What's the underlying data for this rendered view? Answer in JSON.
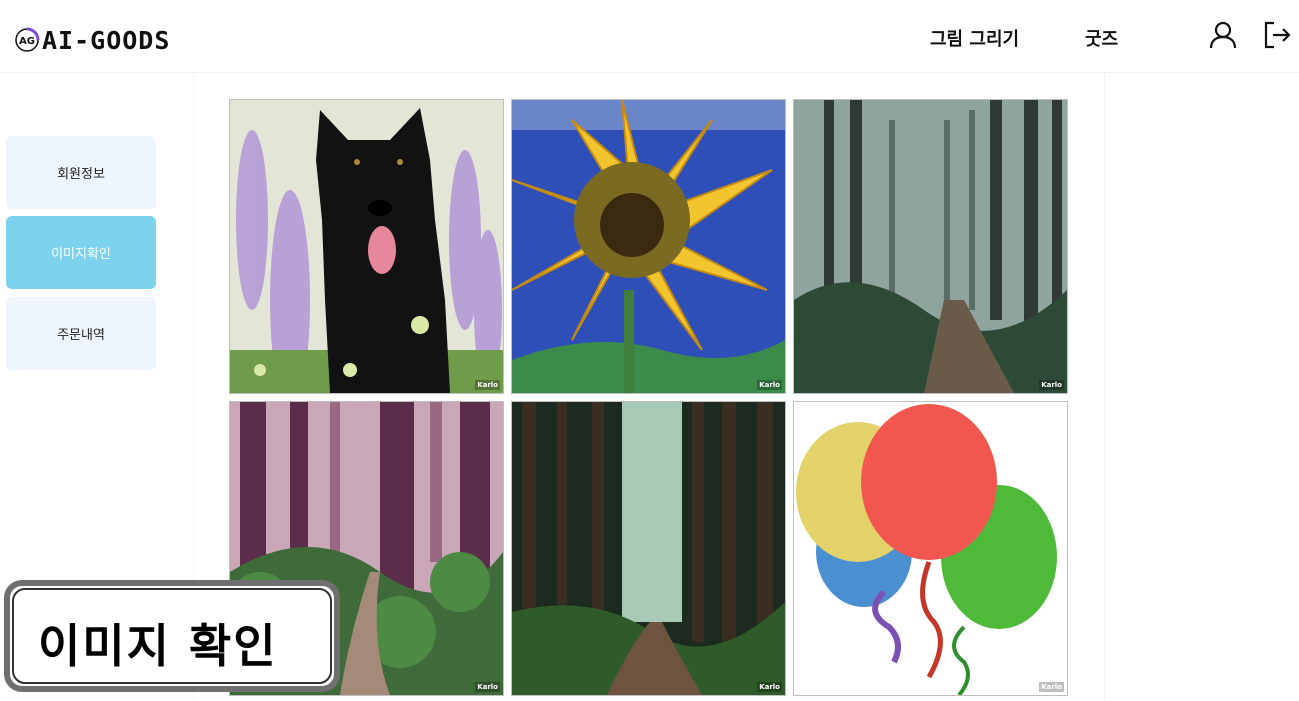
{
  "header": {
    "logo_text": "AI-GOODS",
    "logo_mark_text": "AG",
    "nav": {
      "draw_label": "그림 그리기",
      "goods_label": "굿즈"
    },
    "icons": [
      "user-icon",
      "logout-icon"
    ]
  },
  "sidebar": {
    "items": [
      {
        "label": "회원정보",
        "active": false
      },
      {
        "label": "이미지확인",
        "active": true
      },
      {
        "label": "주문내역",
        "active": false
      }
    ],
    "accent_color": "#7dd3ee",
    "item_bg": "#eef5fd"
  },
  "gallery": {
    "watermark": "Karlo",
    "images": [
      {
        "subject": "black-dog-lavender"
      },
      {
        "subject": "sunflower-painting"
      },
      {
        "subject": "misty-forest-path"
      },
      {
        "subject": "illustrated-purple-forest"
      },
      {
        "subject": "dense-forest-trail"
      },
      {
        "subject": "balloons"
      }
    ]
  },
  "overlay": {
    "text": "이미지 확인"
  }
}
